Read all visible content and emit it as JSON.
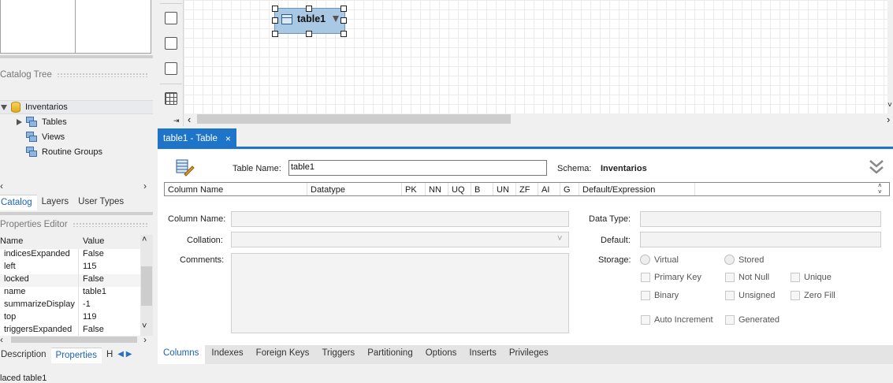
{
  "left": {
    "catalog_tree_title": "Catalog Tree",
    "tree": {
      "schema": "Inventarios",
      "items": [
        "Tables",
        "Views",
        "Routine Groups"
      ]
    },
    "tabs": [
      "Catalog",
      "Layers",
      "User Types"
    ],
    "active_tab": "Catalog",
    "properties_title": "Properties Editor",
    "props_head": {
      "name": "Name",
      "value": "Value"
    },
    "props": [
      {
        "name": "indicesExpanded",
        "value": "False"
      },
      {
        "name": "left",
        "value": "115"
      },
      {
        "name": "locked",
        "value": "False"
      },
      {
        "name": "name",
        "value": "table1"
      },
      {
        "name": "summarizeDisplay",
        "value": "-1"
      },
      {
        "name": "top",
        "value": "119"
      },
      {
        "name": "triggersExpanded",
        "value": "False"
      }
    ],
    "bottom_tabs": [
      "Description",
      "Properties",
      "H"
    ],
    "status": "laced table1"
  },
  "canvas": {
    "table_figure": "table1"
  },
  "editor": {
    "tab_label": "table1 - Table",
    "tab_close": "×",
    "table_name_label": "Table Name:",
    "table_name_value": "table1",
    "schema_label": "Schema:",
    "schema_value": "Inventarios",
    "grid_headers": [
      "Column Name",
      "Datatype",
      "PK",
      "NN",
      "UQ",
      "B",
      "UN",
      "ZF",
      "AI",
      "G",
      "Default/Expression"
    ],
    "column_name_label": "Column Name:",
    "collation_label": "Collation:",
    "comments_label": "Comments:",
    "data_type_label": "Data Type:",
    "default_label": "Default:",
    "storage_label": "Storage:",
    "storage_options": [
      "Virtual",
      "Stored"
    ],
    "flags": [
      "Primary Key",
      "Not Null",
      "Unique",
      "Binary",
      "Unsigned",
      "Zero Fill",
      "Auto Increment",
      "Generated"
    ],
    "bottom_tabs": [
      "Columns",
      "Indexes",
      "Foreign Keys",
      "Triggers",
      "Partitioning",
      "Options",
      "Inserts",
      "Privileges"
    ],
    "active_bottom_tab": "Columns"
  },
  "colors": {
    "accent": "#1e74c8",
    "table_fill": "#a9c8e3"
  }
}
